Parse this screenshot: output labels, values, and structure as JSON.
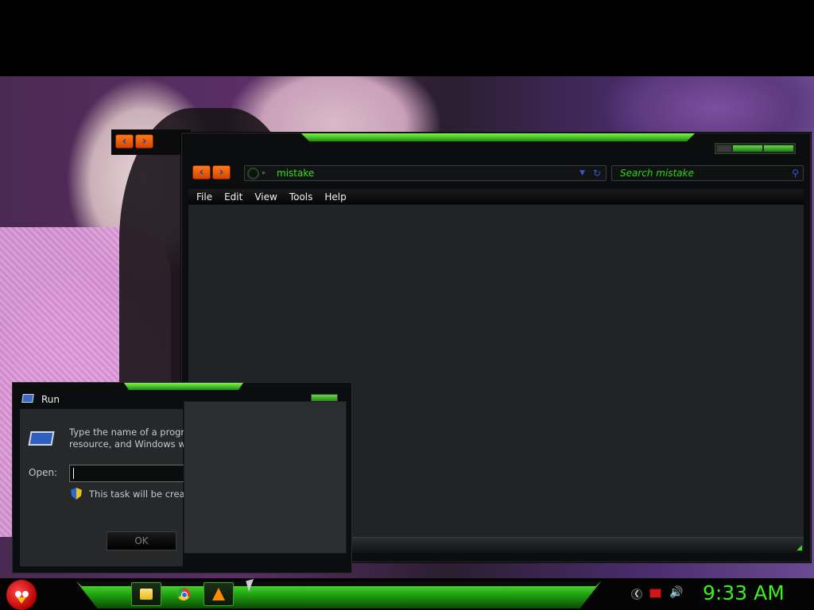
{
  "explorer": {
    "address": "mistake",
    "search_placeholder": "Search mistake",
    "menu": [
      "File",
      "Edit",
      "View",
      "Tools",
      "Help"
    ]
  },
  "run": {
    "title": "Run",
    "description_line1": "Type the name of a progra",
    "description_line2": "resource, and Windows wi",
    "open_label": "Open:",
    "open_value": "",
    "task_note": "This task will be create",
    "ok_label": "OK"
  },
  "taskbar": {
    "apps": [
      "folder-icon",
      "chrome-icon",
      "vlc-icon"
    ],
    "clock": "9:33 AM"
  },
  "colors": {
    "accent_green": "#3bf01e",
    "nav_orange": "#ff7a1a"
  }
}
